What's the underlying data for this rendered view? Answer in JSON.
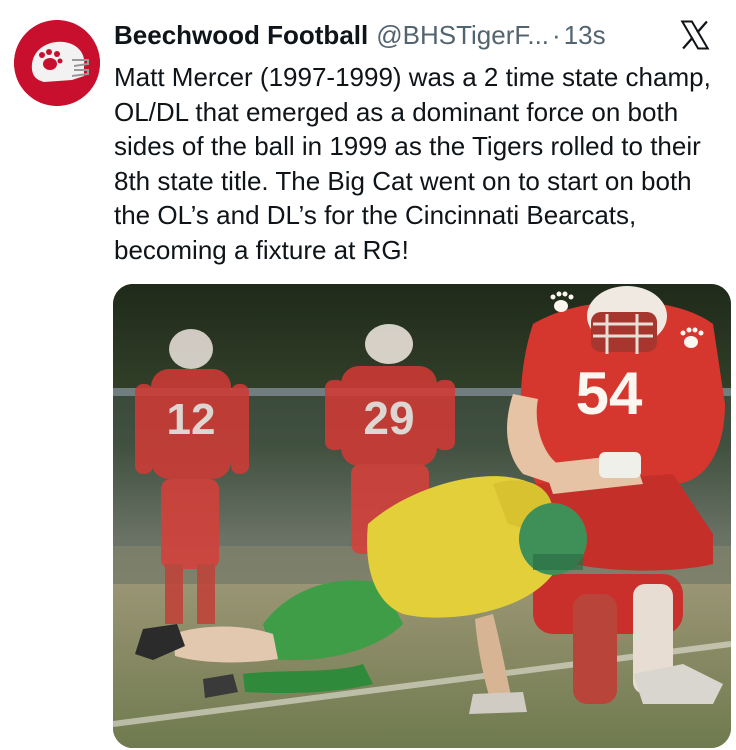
{
  "post": {
    "author": {
      "display_name": "Beechwood Football",
      "handle": "@BHSTigerF...",
      "avatar_icon": "tiger-paw-helmet-icon"
    },
    "separator": "·",
    "timestamp": "13s",
    "platform_icon": "x-logo-icon",
    "text": "Matt Mercer (1997-1999) was a 2 time state champ, OL/DL that emerged as a dominant force on both sides of the ball in 1999 as the Tigers rolled to their 8th state title. The Big Cat went on to start on both the OL’s and DL’s for the Cincinnati Bearcats, becoming a fixture at RG!",
    "media": {
      "jersey_numbers": [
        "12",
        "29",
        "54"
      ]
    }
  },
  "colors": {
    "brand_red": "#c8102e",
    "text_primary": "#0f1419",
    "text_secondary": "#536471"
  }
}
